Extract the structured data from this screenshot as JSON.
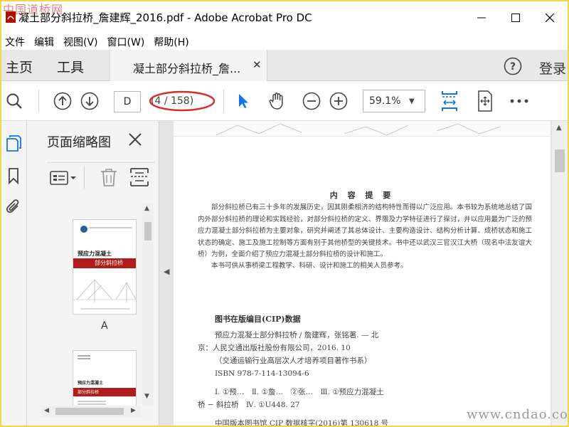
{
  "window": {
    "title": "凝土部分斜拉桥_詹建辉_2016.pdf - Adobe Acrobat Pro DC"
  },
  "watermarks": {
    "top_left": "中国道桥网",
    "bottom_right": "www.cndao.com"
  },
  "menu": [
    "文件",
    "编辑",
    "视图(V)",
    "窗口(W)",
    "帮助(H)"
  ],
  "tabs": {
    "home": "主页",
    "tools": "工具",
    "document": "凝土部分斜拉桥_詹...",
    "login": "登录"
  },
  "toolbar": {
    "page_current": "D",
    "page_count": "(4 / 158)",
    "zoom": "59.1%",
    "highlight_color": "#d62c2c",
    "accent_color": "#1473e6"
  },
  "icons": {
    "search": "search-icon",
    "prev_page": "arrow-up-icon",
    "next_page": "arrow-down-icon",
    "select": "cursor-icon",
    "hand": "hand-icon",
    "zoom_out": "zoom-out-icon",
    "zoom_in": "zoom-in-icon",
    "fit_width": "fit-width-icon",
    "full_screen": "full-screen-icon",
    "more": "more-icon",
    "help": "help-icon",
    "thumbnails": "pages-icon",
    "bookmarks": "bookmark-icon",
    "attachments": "paperclip-icon"
  },
  "sidebar": {
    "panel_title": "页面缩略图",
    "thumbnails": [
      {
        "label": "A",
        "cover_title": "预应力混凝土",
        "cover_subtitle": "部分斜拉桥"
      },
      {
        "label": "",
        "cover_title": "预应力混凝土",
        "cover_subtitle": "部分斜拉桥"
      }
    ]
  },
  "document": {
    "heading": "内 容 提 要",
    "abstract": "部分斜拉桥已有三十多年的发展历史，因其刚柔相济的结构特性而得以广泛应用。本书较为系统地总结了国内外部分斜拉桥的理论和实践经验，对部分斜拉桥的定义、界限及力学特征进行了探讨，并以应用最为广泛的预应力混凝土部分斜拉桥为主要对象，研究并阐述了其总体设计、主要构造设计、结构分析计算、成桥状态和施工状态的确定、施工及施工控制等方面有别于其他桥型的关键技术。书中还以武汉三官汉江大桥（现名中法友谊大桥）为例，全面介绍了预应力混凝土部分斜拉桥的设计和施工。",
    "abstract_2": "本书可供从事桥梁工程教学、科研、设计和施工的相关人员参考。",
    "cip_title": "图书在版编目(CIP)数据",
    "cip_lines": [
      "预应力混凝土部分斜拉桥 / 詹建辉，张铭著. — 北",
      "京：人民交通出版社股份有限公司，2016. 10",
      "（交通运输行业高层次人才培养项目著作书系）",
      "ISBN 978-7-114-13094-6",
      "Ⅰ. ①预…　Ⅱ. ①詹…　②张…　Ⅲ. ①预应力混凝土",
      "桥 − 斜拉桥　Ⅳ. ①U448. 27",
      "中国版本图书馆 CIP 数据核字(2016)第 130618 号"
    ]
  }
}
